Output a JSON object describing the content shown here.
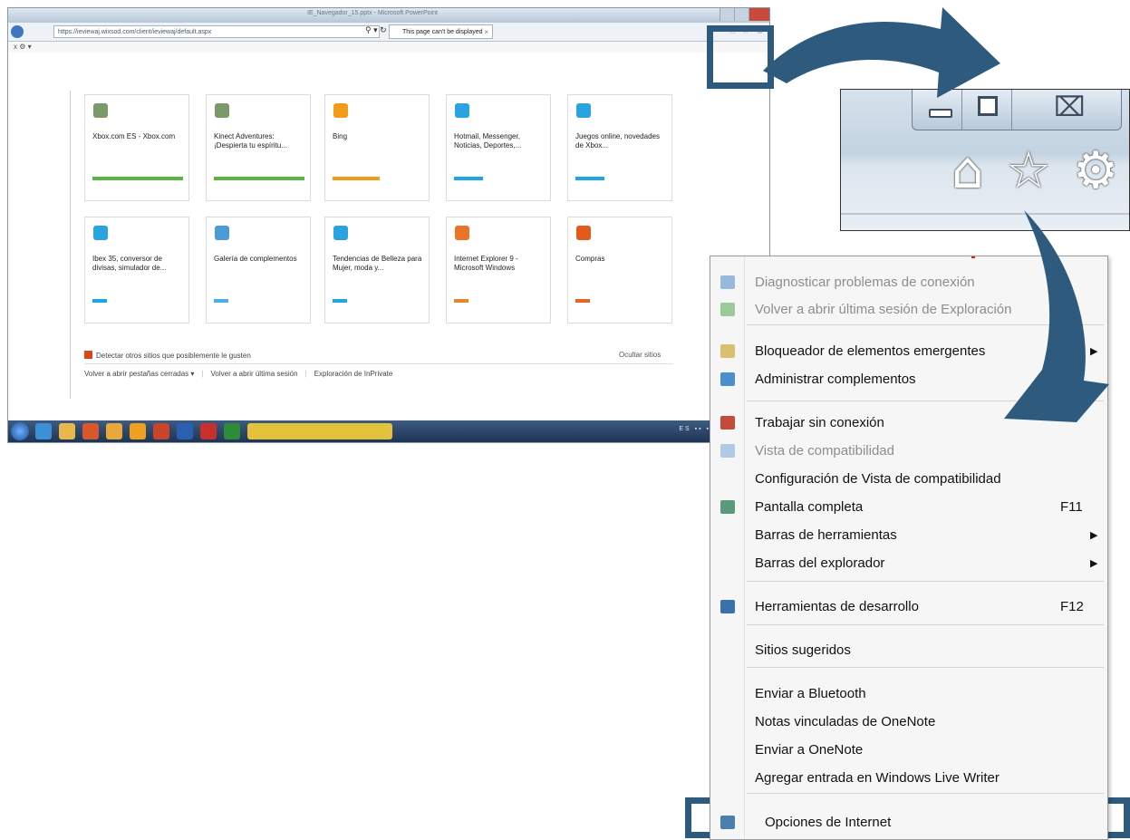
{
  "browser": {
    "window_title": "IE_Navegador_15.pptx - Microsoft PowerPoint",
    "url": "https://ieviewaj.wixsod.com/client/ieviewaj/default.aspx",
    "addr_actions": "⚲ ▾ ↻",
    "tab_label": "This page can't be displayed",
    "tab_close": "×",
    "toolbar_icons": "⌂ ☆ ⚙",
    "cmd_bar": "x ⚙ ▾",
    "tiles": [
      {
        "title": "Xbox.com ES - Xbox.com",
        "icon": "xbox-icon",
        "icon_color": "#7a9a6a",
        "bar_color": "#5cb446"
      },
      {
        "title": "Kinect Adventures: ¡Despierta tu espíritu...",
        "icon": "xbox-icon",
        "icon_color": "#7a9a6a",
        "bar_color": "#5cb446"
      },
      {
        "title": "Bing",
        "icon": "bing-icon",
        "icon_color": "#f39c1b",
        "bar_color": "#f39c1b"
      },
      {
        "title": "Hotmail, Messenger, Noticias, Deportes,...",
        "icon": "msn-butterfly-icon",
        "icon_color": "#2aa4e0",
        "bar_color": "#1aa7e2"
      },
      {
        "title": "Juegos online, novedades de Xbox...",
        "icon": "msn-butterfly-icon",
        "icon_color": "#2aa4e0",
        "bar_color": "#1aa7e2"
      },
      {
        "title": "Ibex 35, conversor de divisas, simulador de...",
        "icon": "msn-butterfly-icon",
        "icon_color": "#2aa4e0",
        "bar_color": "#1aa7e2"
      },
      {
        "title": "Galería de complementos",
        "icon": "addons-gallery-icon",
        "icon_color": "#4b9bd6",
        "bar_color": "#4bb2e6"
      },
      {
        "title": "Tendencias de Belleza para Mujer, moda y...",
        "icon": "msn-butterfly-icon",
        "icon_color": "#2aa4e0",
        "bar_color": "#1aa7e2"
      },
      {
        "title": "Internet Explorer 9 - Microsoft Windows",
        "icon": "windows-icon",
        "icon_color": "#e9742a",
        "bar_color": "#e2892e"
      },
      {
        "title": "Compras",
        "icon": "shopping-icon",
        "icon_color": "#e25a1c",
        "bar_color": "#e8632c"
      }
    ],
    "suggest_label": "Detectar otros sitios que posiblemente le gusten",
    "hide_sites": "Ocultar sitios",
    "reopen_tabs": "Volver a abrir pestañas cerradas ▾",
    "reopen_session": "Volver a abrir última sesión",
    "inprivate": "Exploración de InPrivate",
    "tray_text": "ES ▪▪ ▪ ▪ ▪ ▪ ▪ ▪ ▪ ▪"
  },
  "zoom": {
    "close_symbol": "⌧",
    "home_symbol": "⌂",
    "star_symbol": "☆",
    "gear_symbol": "⚙"
  },
  "menu": {
    "items": [
      {
        "label": "Diagnosticar problemas de conexión",
        "disabled": true,
        "shortcut": "",
        "submenu": false
      },
      {
        "label": "Volver a abrir última sesión de Exploración",
        "disabled": true,
        "shortcut": "",
        "submenu": false
      },
      {
        "label": "Bloqueador de elementos emergentes",
        "disabled": false,
        "shortcut": "",
        "submenu": true
      },
      {
        "label": "Administrar complementos",
        "disabled": false,
        "shortcut": "",
        "submenu": false
      },
      {
        "label": "Trabajar sin conexión",
        "disabled": false,
        "shortcut": "",
        "submenu": false
      },
      {
        "label": "Vista de compatibilidad",
        "disabled": true,
        "shortcut": "",
        "submenu": false
      },
      {
        "label": "Configuración de Vista de compatibilidad",
        "disabled": false,
        "shortcut": "",
        "submenu": false
      },
      {
        "label": "Pantalla completa",
        "disabled": false,
        "shortcut": "F11",
        "submenu": false
      },
      {
        "label": "Barras de herramientas",
        "disabled": false,
        "shortcut": "",
        "submenu": true
      },
      {
        "label": "Barras del explorador",
        "disabled": false,
        "shortcut": "",
        "submenu": true
      },
      {
        "label": "Herramientas de desarrollo",
        "disabled": false,
        "shortcut": "F12",
        "submenu": false
      },
      {
        "label": "Sitios sugeridos",
        "disabled": false,
        "shortcut": "",
        "submenu": false
      },
      {
        "label": "Enviar a Bluetooth",
        "disabled": false,
        "shortcut": "",
        "submenu": false
      },
      {
        "label": "Notas vinculadas de OneNote",
        "disabled": false,
        "shortcut": "",
        "submenu": false
      },
      {
        "label": "Enviar a OneNote",
        "disabled": false,
        "shortcut": "",
        "submenu": false
      },
      {
        "label": "Agregar entrada en Windows Live Writer",
        "disabled": false,
        "shortcut": "",
        "submenu": false
      },
      {
        "label": "Opciones de Internet",
        "disabled": false,
        "shortcut": "",
        "submenu": false
      }
    ],
    "submenu_arrow": "▶"
  },
  "colors": {
    "highlight": "#2e5a7e",
    "arrow": "#2e5a7e"
  }
}
